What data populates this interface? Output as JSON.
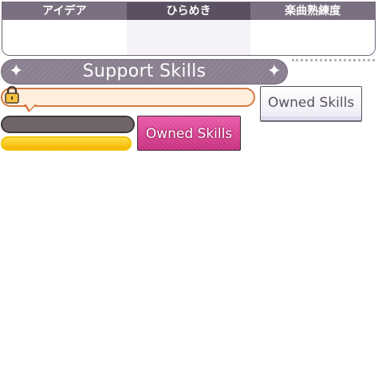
{
  "tabs": [
    {
      "label": "アイデア",
      "active": false
    },
    {
      "label": "ひらめき",
      "active": true
    },
    {
      "label": "楽曲熟練度",
      "active": false
    }
  ],
  "banner": {
    "title": "Support Skills",
    "decoration_icon": "sparkle-star-icon"
  },
  "lock_bubble": {
    "icon": "lock-icon",
    "text": ""
  },
  "buttons": {
    "owned_skills_white": "Owned Skills",
    "owned_skills_pink": "Owned Skills"
  },
  "colors": {
    "tab_inactive": "#7b7081",
    "tab_active": "#5a5061",
    "banner": "#8a7f90",
    "bubble_border": "#d8783f",
    "bubble_fill": "#fdeede",
    "pink_button": "#d9418f",
    "yellow_bar": "#f7c200",
    "dark_pill": "#6f6568"
  }
}
